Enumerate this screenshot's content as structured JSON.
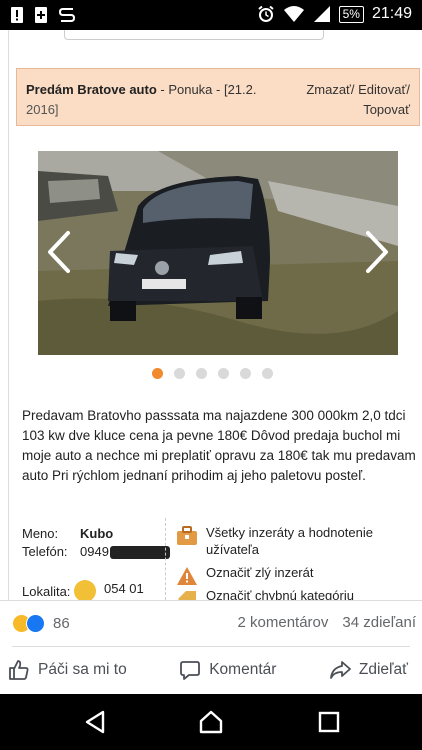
{
  "status_bar": {
    "icons_left": [
      "alert-icon",
      "plus-box-icon",
      "s-app-icon"
    ],
    "icons_right": [
      "alarm-icon",
      "wifi-icon",
      "signal-icon"
    ],
    "battery": "5%",
    "time": "21:49"
  },
  "ad": {
    "title": "Predám Bratove auto",
    "subtitle": " - Ponuka - [21.2.",
    "date_tail": "2016]",
    "actions_line1": "Zmazať/ Editovať/",
    "actions_line2": "Topovať",
    "gallery": {
      "dot_count": 6,
      "active_dot": 0
    },
    "description": "Predavam Bratovho passsata ma najazdene 300 000km 2,0 tdci 103 kw dve kluce cena ja pevne 180€ Dôvod predaja buchol mi moje auto a nechce mi preplatiť opravu za 180€ tak mu predavam auto Pri rýchlom jednaní prihodim aj jeho paletovu posteľ.",
    "seller": {
      "name_label": "Meno:",
      "name_value": "Kubo",
      "phone_label": "Telefón:",
      "phone_value": "0949",
      "location_label": "Lokalita:",
      "location_value": "054 01"
    },
    "side_actions": [
      {
        "icon": "bag-icon",
        "label": "Všetky inzeráty a hodnotenie užívateľa"
      },
      {
        "icon": "warning-icon",
        "label": "Označiť zlý inzerát"
      },
      {
        "icon": "tag-icon",
        "label": "Označiť chybnú kategóriu"
      }
    ]
  },
  "post": {
    "reaction_count": "86",
    "comments": "2 komentárov",
    "shares": "34 zdieľaní",
    "like_label": "Páči sa mi to",
    "comment_label": "Komentár",
    "share_label": "Zdieľať"
  }
}
